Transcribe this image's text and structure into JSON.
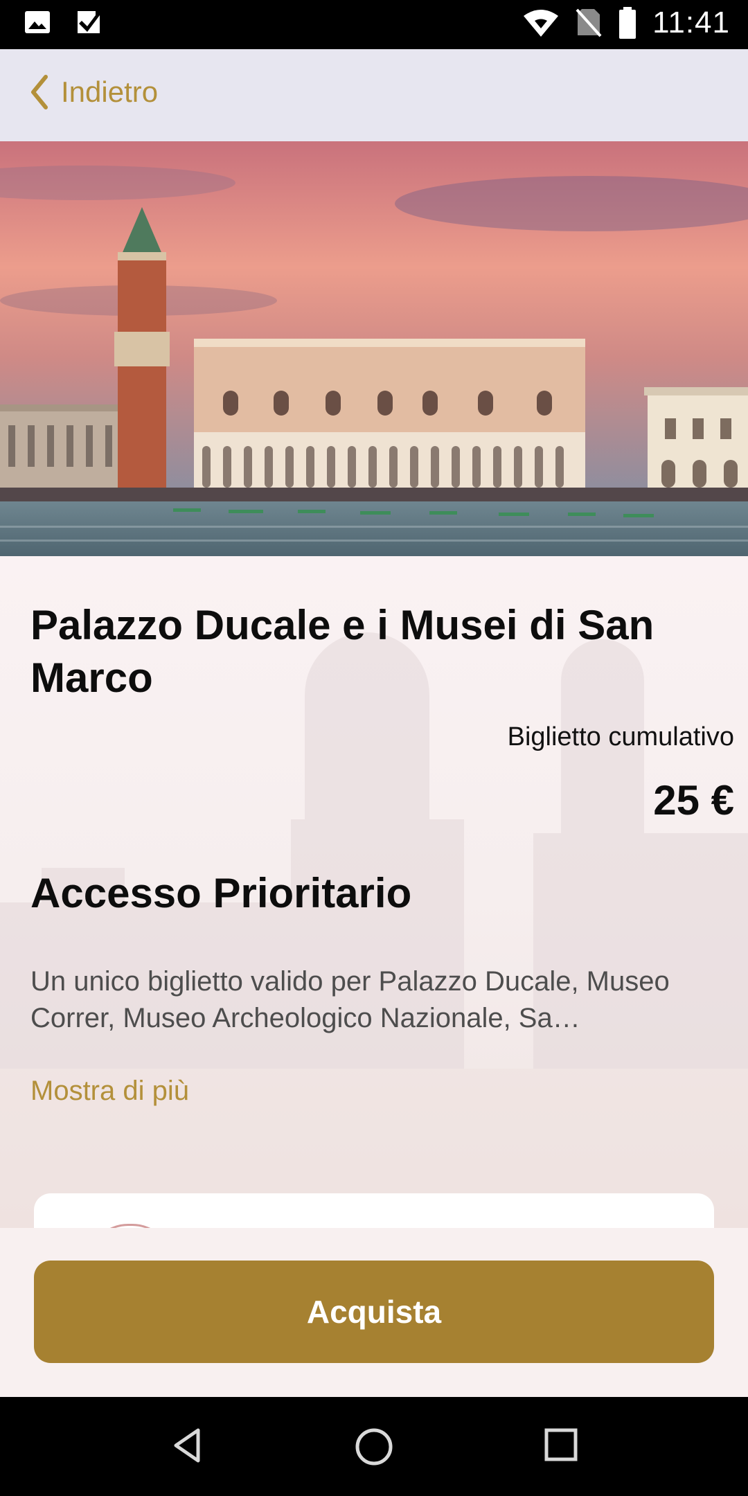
{
  "status_bar": {
    "time": "11:41",
    "left_icons": [
      "image-icon",
      "checkbox-icon"
    ],
    "right_icons": [
      "wifi-icon",
      "no-sim-icon",
      "battery-icon"
    ]
  },
  "nav": {
    "back_label": "Indietro"
  },
  "attraction": {
    "title": "Palazzo Ducale e i Musei di San Marco",
    "ticket_type": "Biglietto cumulativo",
    "price": "25 €",
    "section_title": "Accesso Prioritario",
    "description": "Un unico biglietto valido per Palazzo Ducale, Museo Correr, Museo Archeologico Nazionale, Sa…",
    "more_label": "Mostra di più"
  },
  "buy_button_label": "Acquista",
  "colors": {
    "accent": "#b3903a",
    "button": "#a68131"
  },
  "system_nav": [
    "back-triangle-icon",
    "home-circle-icon",
    "recents-square-icon"
  ]
}
